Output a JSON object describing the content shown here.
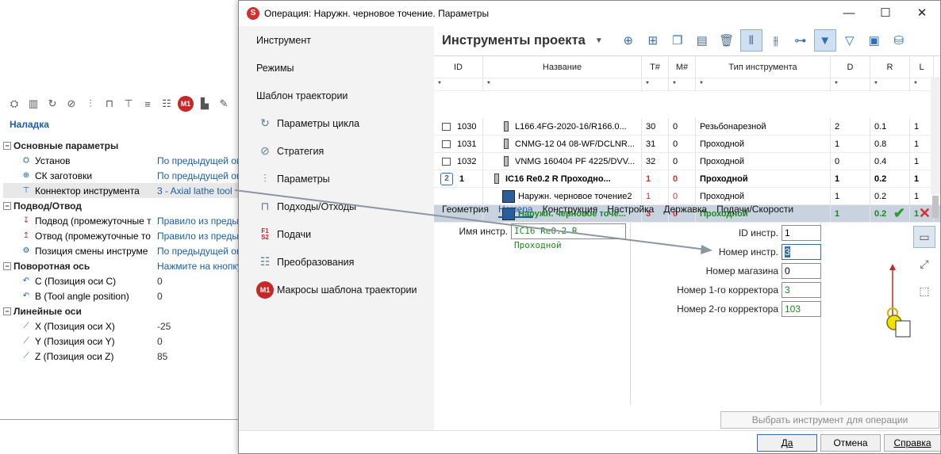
{
  "background_panel": {
    "title": "Наладка",
    "tree": [
      {
        "label": "Основные параметры",
        "value": "",
        "group": true
      },
      {
        "label": "Установ",
        "value": "По предыдущей опе"
      },
      {
        "label": "СК заготовки",
        "value": "По предыдущей опе"
      },
      {
        "label": "Коннектор инструмента",
        "value": "3 - Axial lathe tool"
      },
      {
        "label": "Подвод/Отвод",
        "value": "",
        "group": true
      },
      {
        "label": "Подвод (промежуточные т",
        "value": "Правило из предыду"
      },
      {
        "label": "Отвод (промежуточные то",
        "value": "Правило из предыду"
      },
      {
        "label": "Позиция смены инструме",
        "value": "По предыдущей опе"
      },
      {
        "label": "Поворотная ось",
        "value": "Нажмите на кнопку",
        "group": true
      },
      {
        "label": "C (Позиция оси C)",
        "value": "0"
      },
      {
        "label": "B (Tool angle position)",
        "value": "0"
      },
      {
        "label": "Линейные оси",
        "value": "",
        "group": true
      },
      {
        "label": "X (Позиция оси X)",
        "value": "-25"
      },
      {
        "label": "Y (Позиция оси Y)",
        "value": "0"
      },
      {
        "label": "Z (Позиция оси Z)",
        "value": "85"
      }
    ],
    "toolbar_labels": {
      "m1": "M1"
    }
  },
  "dialog": {
    "title": "Операция: Наружн. черновое точение. Параметры",
    "nav": [
      {
        "label": "Инструмент"
      },
      {
        "label": "Режимы"
      },
      {
        "label": "Шаблон траектории"
      },
      {
        "label": "Параметры цикла"
      },
      {
        "label": "Стратегия"
      },
      {
        "label": "Параметры"
      },
      {
        "label": "Подходы/Отходы"
      },
      {
        "label": "Подачи"
      },
      {
        "label": "Преобразования"
      },
      {
        "label": "Макросы шаблона траектории"
      }
    ],
    "nav_icon_text": {
      "m1": "M1",
      "f1": "F1",
      "s2": "S2"
    },
    "project_tools_title": "Инструменты проекта",
    "table": {
      "headers": [
        "ID",
        "Название",
        "T#",
        "M#",
        "Тип инструмента",
        "D",
        "R",
        "L"
      ],
      "filter_symbol": "*",
      "rows": [
        {
          "id": "1030",
          "name": "L166.4FG-2020-16/R166.0...",
          "t": "30",
          "m": "0",
          "type": "Резьбонарезной",
          "d": "2",
          "r": "0.1",
          "l": "1"
        },
        {
          "id": "1031",
          "name": "CNMG-12 04 08-WF/DCLNR...",
          "t": "31",
          "m": "0",
          "type": "Проходной",
          "d": "1",
          "r": "0.8",
          "l": "1"
        },
        {
          "id": "1032",
          "name": "VNMG 160404 PF 4225/DVV...",
          "t": "32",
          "m": "0",
          "type": "Проходной",
          "d": "0",
          "r": "0.4",
          "l": "1"
        },
        {
          "id": "1",
          "name": "IC16 Re0.2 R Проходно...",
          "t": "1",
          "m": "0",
          "type": "Проходной",
          "d": "1",
          "r": "0.2",
          "l": "1"
        },
        {
          "id": "",
          "name": "Наружн. черновое точение2",
          "t": "1",
          "m": "0",
          "type": "Проходной",
          "d": "1",
          "r": "0.2",
          "l": "1"
        },
        {
          "id": "",
          "name": "Наружн. черновое точе...",
          "t": "3",
          "m": "0",
          "type": "Проходной",
          "d": "1",
          "r": "0.2",
          "l": "1"
        }
      ]
    },
    "tabs": [
      "Геометрия",
      "Номера",
      "Конструкция",
      "Настройка",
      "Державка",
      "Подачи/Скорости"
    ],
    "active_tab": "Номера",
    "form": {
      "tool_name_label": "Имя инстр.",
      "tool_name_value": "IC16 Re0.2 R Проходной",
      "id_label": "ID инстр.",
      "id_value": "1",
      "tool_number_label": "Номер инстр.",
      "tool_number_value": "3",
      "magazine_label": "Номер магазина",
      "magazine_value": "0",
      "corrector1_label": "Номер 1-го корректора",
      "corrector1_value": "3",
      "corrector2_label": "Номер 2-го корректора",
      "corrector2_value": "103"
    },
    "select_tool_button": "Выбрать инструмент для операции",
    "buttons": {
      "ok": "Да",
      "cancel": "Отмена",
      "help": "Справка"
    }
  },
  "colors": {
    "accent": "#1a5ea8",
    "green": "#1b8a1b",
    "red": "#d32f2f",
    "selection": "#c8d3df"
  }
}
